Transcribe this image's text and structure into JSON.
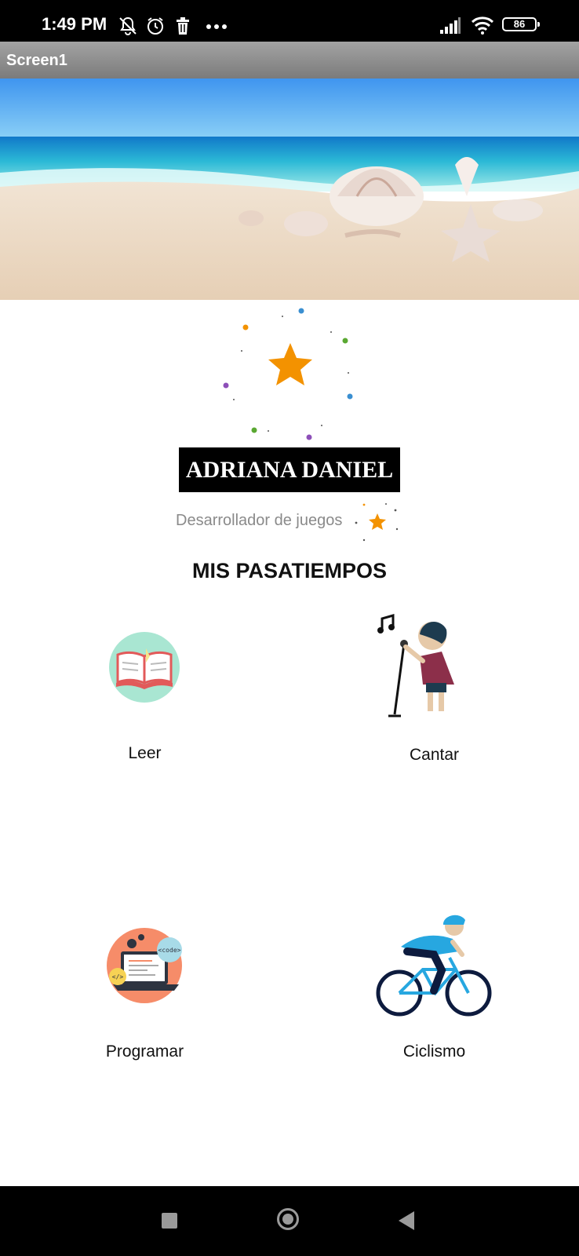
{
  "status_bar": {
    "time": "1:49 PM",
    "battery": "86",
    "icons": [
      "mute-notifications-icon",
      "alarm-icon",
      "trash-icon",
      "more-dots-icon",
      "signal-icon",
      "wifi-icon",
      "battery-icon"
    ]
  },
  "app_bar": {
    "title": "Screen1"
  },
  "profile": {
    "name": "ADRIANA DANIEL",
    "role": "Desarrollador de juegos",
    "accent_color": "#F39200"
  },
  "hobbies": {
    "title": "MIS PASATIEMPOS",
    "items": [
      {
        "label": "Leer",
        "icon": "open-book-icon"
      },
      {
        "label": "Cantar",
        "icon": "singer-icon"
      },
      {
        "label": "Programar",
        "icon": "laptop-code-icon"
      },
      {
        "label": "Ciclismo",
        "icon": "cyclist-icon"
      }
    ]
  },
  "nav_bar": {
    "icons": [
      "recent-apps-icon",
      "home-icon",
      "back-icon"
    ]
  }
}
